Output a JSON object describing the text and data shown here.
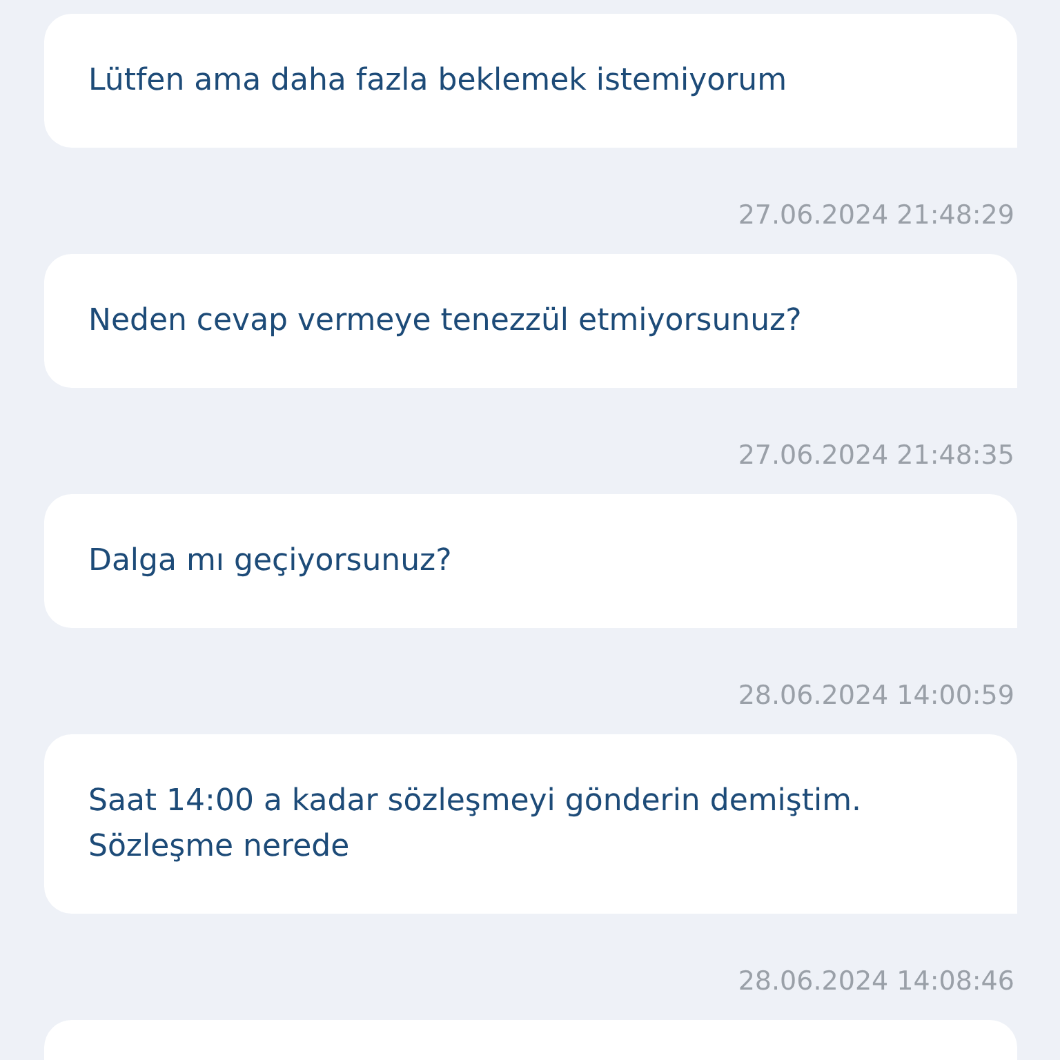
{
  "chat": [
    {
      "kind": "message",
      "text": "Lütfen ama daha fazla beklemek istemiyorum"
    },
    {
      "kind": "timestamp",
      "text": "27.06.2024 21:48:29"
    },
    {
      "kind": "message",
      "text": "Neden cevap vermeye tenezzül etmiyorsunuz?"
    },
    {
      "kind": "timestamp",
      "text": "27.06.2024 21:48:35"
    },
    {
      "kind": "message",
      "text": "Dalga mı geçiyorsunuz?"
    },
    {
      "kind": "timestamp",
      "text": "28.06.2024 14:00:59"
    },
    {
      "kind": "message",
      "text": "Saat 14:00 a kadar sözleşmeyi gönderin demiştim. Sözleşme nerede"
    },
    {
      "kind": "timestamp",
      "text": "28.06.2024 14:08:46"
    },
    {
      "kind": "message"
    }
  ]
}
